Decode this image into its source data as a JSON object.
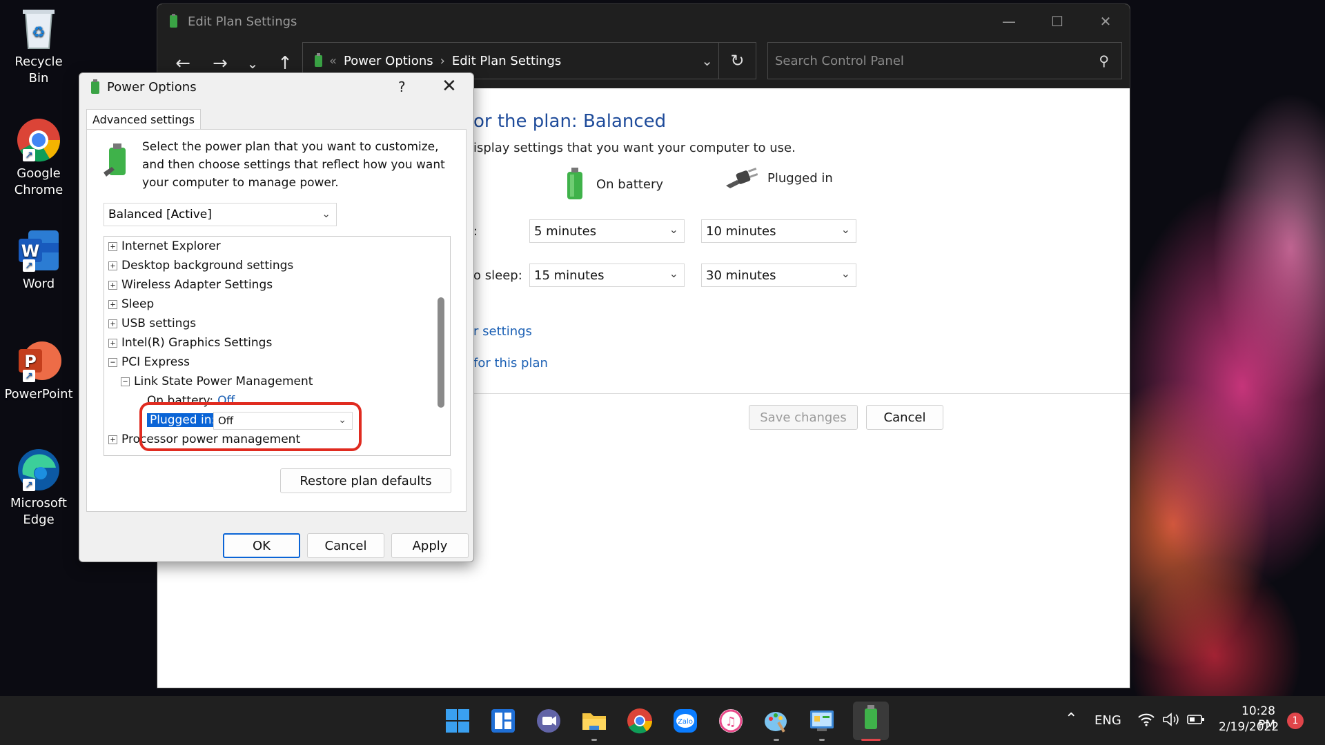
{
  "desktop": {
    "icons": [
      {
        "label": "Recycle Bin"
      },
      {
        "label": "Google Chrome"
      },
      {
        "label": "Word"
      },
      {
        "label": "PowerPoint"
      },
      {
        "label": "Microsoft Edge"
      }
    ]
  },
  "main_window": {
    "title": "Edit Plan Settings",
    "breadcrumb": [
      "Power Options",
      "Edit Plan Settings"
    ],
    "breadcrumb_sep": "›",
    "search_placeholder": "Search Control Panel",
    "plan_title": "or the plan: Balanced",
    "plan_subtitle": "isplay settings that you want your computer to use.",
    "col_battery": "On battery",
    "col_plugged": "Plugged in",
    "rows": [
      {
        "label": ":",
        "battery": "5 minutes",
        "plugged": "10 minutes"
      },
      {
        "label": "o sleep:",
        "battery": "15 minutes",
        "plugged": "30 minutes"
      }
    ],
    "link_1": "r settings",
    "link_2": "for this plan",
    "save_label": "Save changes",
    "cancel_label": "Cancel"
  },
  "dialog": {
    "title": "Power Options",
    "help": "?",
    "tab": "Advanced settings",
    "description": "Select the power plan that you want to customize, and then choose settings that reflect how you want your computer to manage power.",
    "plan_selected": "Balanced [Active]",
    "tree": [
      {
        "label": "Internet Explorer",
        "sign": "+"
      },
      {
        "label": "Desktop background settings",
        "sign": "+"
      },
      {
        "label": "Wireless Adapter Settings",
        "sign": "+"
      },
      {
        "label": "Sleep",
        "sign": "+"
      },
      {
        "label": "USB settings",
        "sign": "+"
      },
      {
        "label": "Intel(R) Graphics Settings",
        "sign": "+"
      },
      {
        "label": "PCI Express",
        "sign": "−"
      },
      {
        "label": "Link State Power Management",
        "sign": "−"
      },
      {
        "label": "Processor power management",
        "sign": "+"
      }
    ],
    "on_battery_label": "On battery:",
    "on_battery_value": "Off",
    "plugged_in_label": "Plugged in:",
    "plugged_in_value": "Off",
    "restore_label": "Restore plan defaults",
    "ok_label": "OK",
    "cancel_label": "Cancel",
    "apply_label": "Apply"
  },
  "taskbar": {
    "lang": "ENG",
    "time": "10:28 PM",
    "date": "2/19/2022",
    "notifications": "1"
  },
  "colors": {
    "accent": "#0a64d6",
    "link": "#1a5fb4",
    "highlight": "#e02b20"
  }
}
